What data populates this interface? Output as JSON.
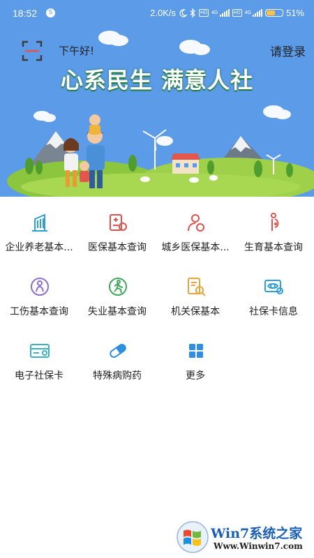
{
  "status_bar": {
    "time": "18:52",
    "net_speed": "2.0K/s",
    "hd1": "HD",
    "net1": "4G",
    "hd2": "HD",
    "net2": "4G",
    "battery_percent": "51%",
    "battery_level": 0.51,
    "icons": [
      "notification-icon",
      "moon-icon",
      "bluetooth-icon",
      "signal-icon",
      "battery-icon"
    ]
  },
  "header": {
    "greeting": "下午好!",
    "login": "请登录",
    "slogan": "心系民生 满意人社"
  },
  "services": [
    {
      "label": "企业养老基本...",
      "icon": "building-icon",
      "color": "#2f9fd8"
    },
    {
      "label": "医保基本查询",
      "icon": "medical-doc-icon",
      "color": "#e0514c"
    },
    {
      "label": "城乡医保基本...",
      "icon": "person-shield-icon",
      "color": "#e0514c"
    },
    {
      "label": "生育基本查询",
      "icon": "pregnant-icon",
      "color": "#e0514c"
    },
    {
      "label": "工伤基本查询",
      "icon": "injury-icon",
      "color": "#8a6ed0"
    },
    {
      "label": "失业基本查询",
      "icon": "runner-icon",
      "color": "#3fa55a"
    },
    {
      "label": "机关保基本",
      "icon": "document-search-icon",
      "color": "#e8a43a"
    },
    {
      "label": "社保卡信息",
      "icon": "card-eye-icon",
      "color": "#2f9fd8"
    },
    {
      "label": "电子社保卡",
      "icon": "e-card-icon",
      "color": "#3bb3c2"
    },
    {
      "label": "特殊病购药",
      "icon": "pill-icon",
      "color": "#2f8ee0"
    },
    {
      "label": "更多",
      "icon": "grid-more-icon",
      "color": "#2f8ee0"
    }
  ],
  "watermark": {
    "text": "Win7系统之家",
    "url": "Www.Winwin7.com"
  }
}
